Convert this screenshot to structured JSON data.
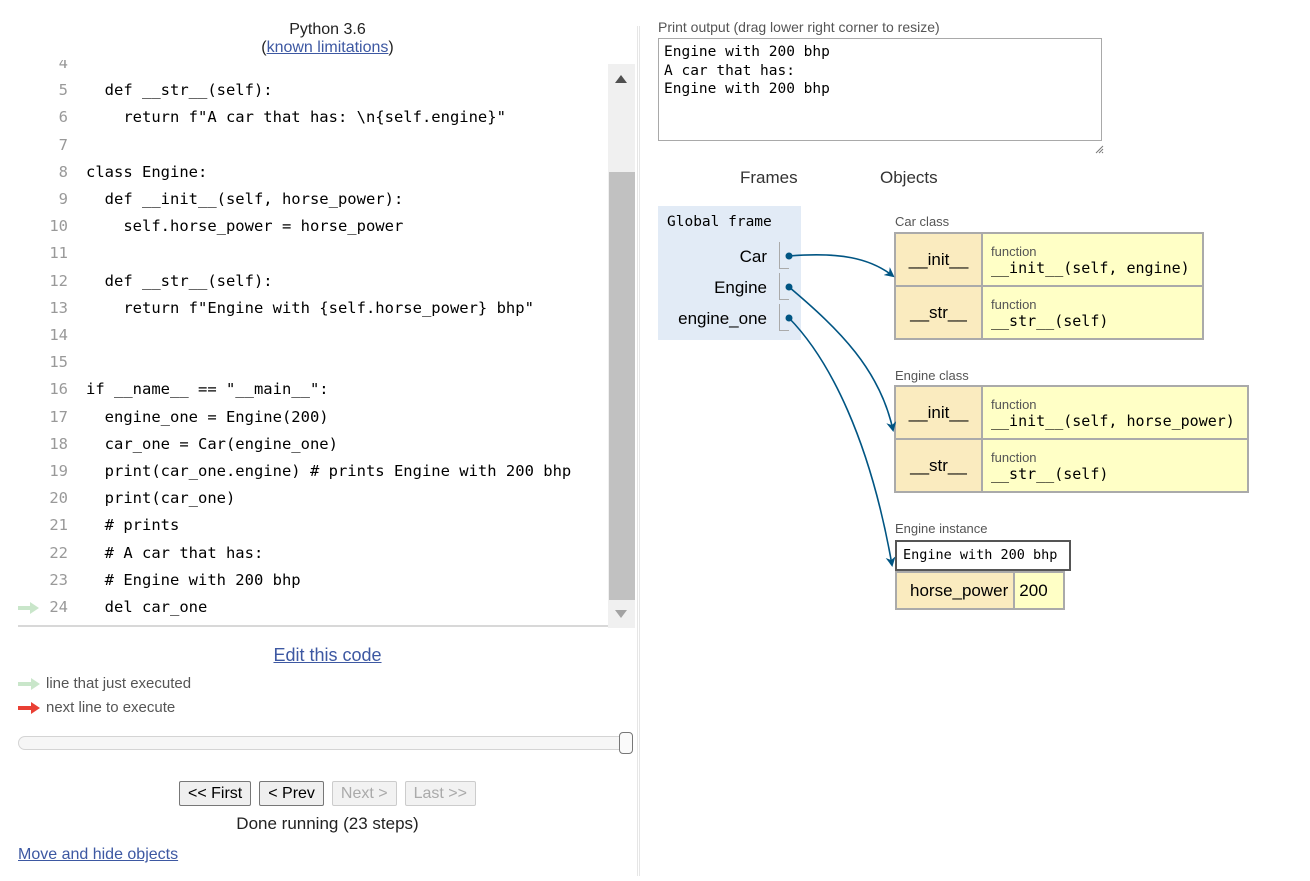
{
  "header": {
    "language": "Python 3.6",
    "limitations_prefix": "(",
    "limitations_link": "known limitations",
    "limitations_suffix": ")"
  },
  "code": {
    "lines": [
      {
        "no": "4",
        "text": ""
      },
      {
        "no": "5",
        "text": "  def __str__(self):"
      },
      {
        "no": "6",
        "text": "    return f\"A car that has: \\n{self.engine}\""
      },
      {
        "no": "7",
        "text": ""
      },
      {
        "no": "8",
        "text": "class Engine:"
      },
      {
        "no": "9",
        "text": "  def __init__(self, horse_power):"
      },
      {
        "no": "10",
        "text": "    self.horse_power = horse_power"
      },
      {
        "no": "11",
        "text": ""
      },
      {
        "no": "12",
        "text": "  def __str__(self):"
      },
      {
        "no": "13",
        "text": "    return f\"Engine with {self.horse_power} bhp\""
      },
      {
        "no": "14",
        "text": ""
      },
      {
        "no": "15",
        "text": ""
      },
      {
        "no": "16",
        "text": "if __name__ == \"__main__\":"
      },
      {
        "no": "17",
        "text": "  engine_one = Engine(200)"
      },
      {
        "no": "18",
        "text": "  car_one = Car(engine_one)"
      },
      {
        "no": "19",
        "text": "  print(car_one.engine) # prints Engine with 200 bhp"
      },
      {
        "no": "20",
        "text": "  print(car_one)"
      },
      {
        "no": "21",
        "text": "  # prints"
      },
      {
        "no": "22",
        "text": "  # A car that has:"
      },
      {
        "no": "23",
        "text": "  # Engine with 200 bhp"
      },
      {
        "no": "24",
        "text": "  del car_one"
      }
    ],
    "just_executed_line": "24",
    "scroll_position": 0.7
  },
  "controls": {
    "edit_link": "Edit this code",
    "legend_just_executed": "line that just executed",
    "legend_next_line": "next line to execute",
    "slider_value": 23,
    "slider_max": 23,
    "first_button": "<< First",
    "prev_button": "< Prev",
    "next_button": "Next >",
    "last_button": "Last >>",
    "status": "Done running (23 steps)",
    "move_hide_link": "Move and hide objects"
  },
  "output": {
    "label": "Print output (drag lower right corner to resize)",
    "text": "Engine with 200 bhp\nA car that has:\nEngine with 200 bhp"
  },
  "visualizer": {
    "frames_header": "Frames",
    "objects_header": "Objects",
    "global_frame": {
      "title": "Global frame",
      "variables": [
        {
          "name": "Car"
        },
        {
          "name": "Engine"
        },
        {
          "name": "engine_one"
        }
      ]
    },
    "car_class": {
      "label": "Car class",
      "members": [
        {
          "key": "__init__",
          "type": "function",
          "signature": "__init__(self, engine)"
        },
        {
          "key": "__str__",
          "type": "function",
          "signature": "__str__(self)"
        }
      ]
    },
    "engine_class": {
      "label": "Engine class",
      "members": [
        {
          "key": "__init__",
          "type": "function",
          "signature": "__init__(self, horse_power)"
        },
        {
          "key": "__str__",
          "type": "function",
          "signature": "__str__(self)"
        }
      ]
    },
    "engine_instance": {
      "label": "Engine instance",
      "repr": "Engine with 200 bhp",
      "attributes": [
        {
          "key": "horse_power",
          "value": "200"
        }
      ]
    }
  },
  "colors": {
    "link": "#3D58A2",
    "frame_bg": "#E2EBF6",
    "key_bg": "#FAEBBF",
    "value_bg": "#FFFFC6",
    "pointer": "#005583",
    "just_executed_arrow": "#C9E6CA",
    "next_line_arrow": "#E93F34"
  }
}
